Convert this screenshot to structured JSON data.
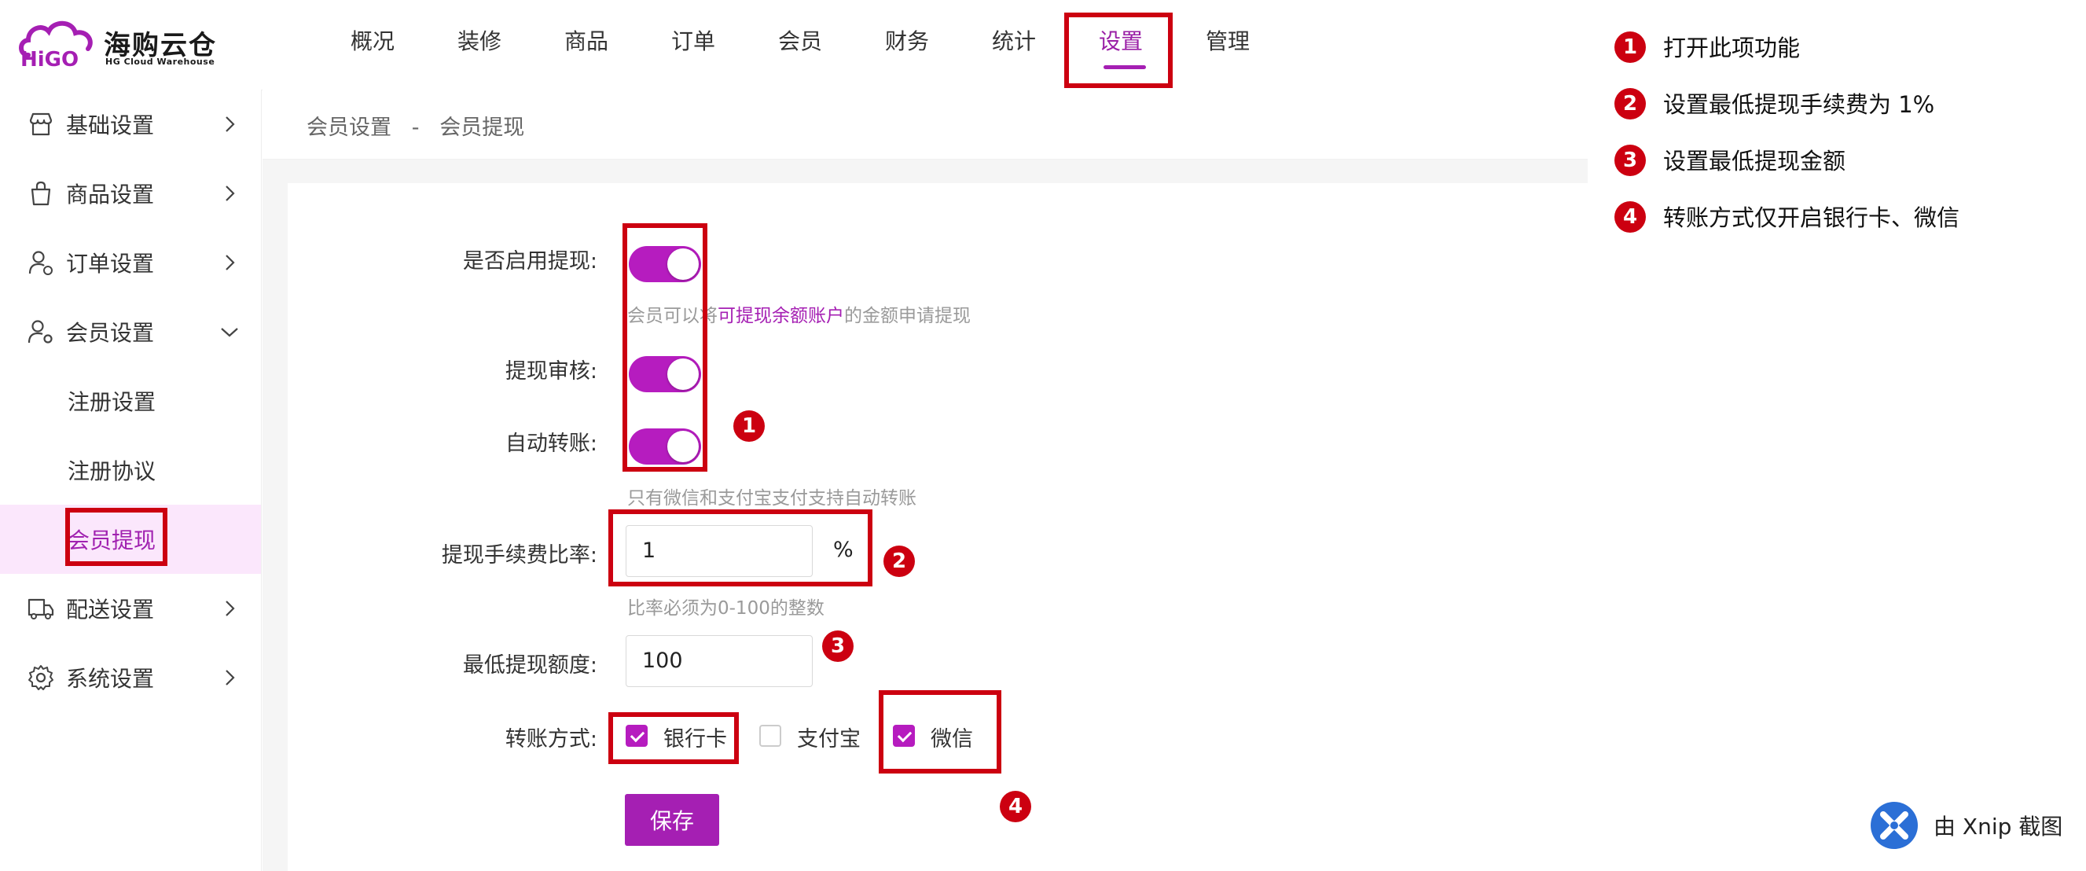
{
  "brand": {
    "name_cn": "海购云仓",
    "name_en": "HG Cloud Warehouse",
    "logo_text": "HiGO"
  },
  "nav": {
    "items": [
      "概况",
      "装修",
      "商品",
      "订单",
      "会员",
      "财务",
      "统计",
      "设置",
      "管理"
    ],
    "active": "设置"
  },
  "sidebar": {
    "items": [
      {
        "label": "基础设置",
        "icon": "store-icon"
      },
      {
        "label": "商品设置",
        "icon": "shopping-bag-icon"
      },
      {
        "label": "订单设置",
        "icon": "user-order-icon"
      },
      {
        "label": "会员设置",
        "icon": "member-gear-icon"
      },
      {
        "label": "配送设置",
        "icon": "truck-icon"
      },
      {
        "label": "系统设置",
        "icon": "gear-icon"
      }
    ],
    "member_sub": [
      "注册设置",
      "注册协议",
      "会员提现"
    ],
    "active_sub": "会员提现"
  },
  "breadcrumb": {
    "text": "会员设置   -   会员提现"
  },
  "form": {
    "enable_label": "是否启用提现:",
    "enable_on": true,
    "enable_hint_pre": "会员可以将",
    "enable_hint_link": "可提现余额账户",
    "enable_hint_post": "的金额申请提现",
    "audit_label": "提现审核:",
    "audit_on": true,
    "auto_label": "自动转账:",
    "auto_on": true,
    "auto_hint": "只有微信和支付宝支付支持自动转账",
    "fee_label": "提现手续费比率:",
    "fee_value": "1",
    "fee_suffix": "%",
    "fee_hint": "比率必须为0-100的整数",
    "min_label": "最低提现额度:",
    "min_value": "100",
    "transfer_label": "转账方式:",
    "transfer_options": [
      {
        "label": "银行卡",
        "checked": true
      },
      {
        "label": "支付宝",
        "checked": false
      },
      {
        "label": "微信",
        "checked": true
      }
    ],
    "save_label": "保存"
  },
  "annotations": {
    "markers": [
      "1",
      "2",
      "3",
      "4"
    ],
    "legend": [
      {
        "num": "1",
        "text": "打开此项功能"
      },
      {
        "num": "2",
        "text": "设置最低提现手续费为 1%"
      },
      {
        "num": "3",
        "text": "设置最低提现金额"
      },
      {
        "num": "4",
        "text": "转账方式仅开启银行卡、微信"
      }
    ],
    "box_color": "#cc0010"
  },
  "colors": {
    "accent": "#a51fb3",
    "active_bg": "#fbe7fc"
  },
  "watermark": {
    "text": "由 Xnip 截图"
  }
}
